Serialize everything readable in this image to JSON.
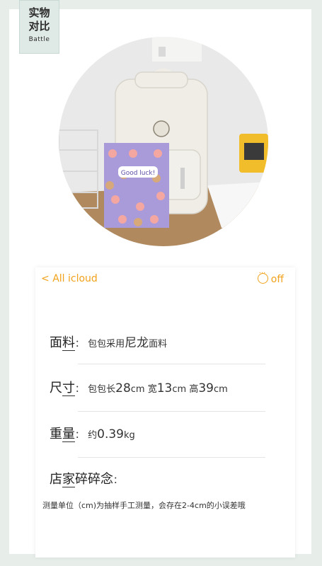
{
  "badge": {
    "line1": "实物",
    "line2": "对比",
    "sub": "Battle"
  },
  "card": {
    "back_label": "All icloud",
    "toggle_label": "off",
    "material": {
      "label_a": "面",
      "label_b": "料",
      "colon": "：",
      "value_a": "包包采用",
      "value_big": "尼龙",
      "value_b": "面料"
    },
    "size": {
      "label_a": "尺",
      "label_b": "寸",
      "colon": "：",
      "value_a": "包包长",
      "v1": "28",
      "u1": "cm",
      "w_a": "宽",
      "v2": "13",
      "u2": "cm",
      "h_a": "高",
      "v3": "39",
      "u3": "cm"
    },
    "weight": {
      "label_a": "重",
      "label_b": "量",
      "colon": "：",
      "value_a": "约",
      "v": "0.39",
      "u": "kg"
    },
    "seller": {
      "label_a": "店",
      "label_b": "家",
      "label_c": "碎碎念",
      "colon": "："
    },
    "note": "测量单位（cm)为抽样手工测量，会存在2-4cm的小误差哦"
  },
  "photo": {
    "notebook_text": "Good luck!",
    "backpack_color": "#efede6",
    "notebook_color": "#a99bd9"
  }
}
